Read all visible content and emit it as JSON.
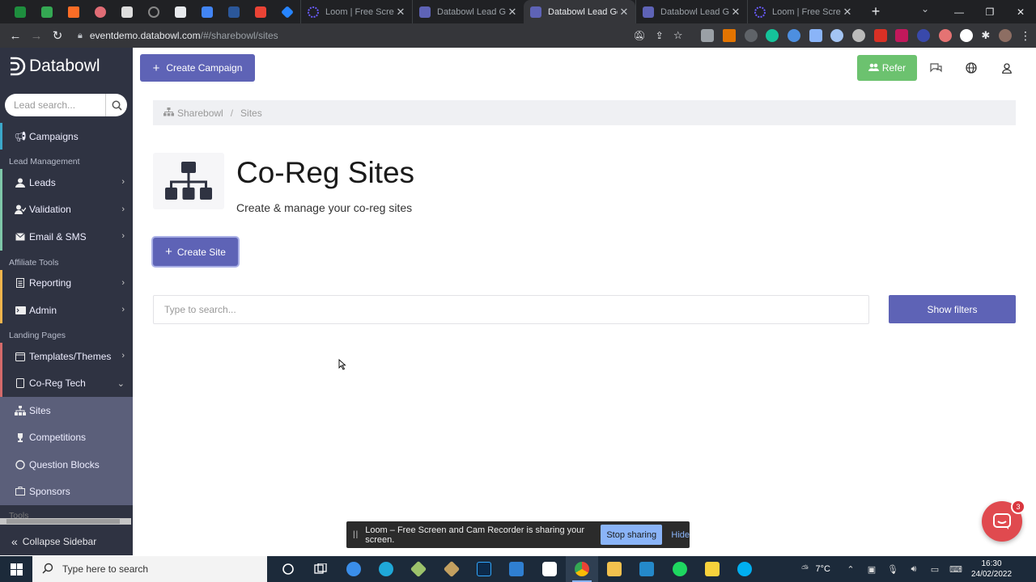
{
  "browser": {
    "tabs": [
      {
        "title": "Loom | Free Screen",
        "fav": "#6a5cff",
        "active": false
      },
      {
        "title": "Databowl Lead Gen",
        "fav": "#5e63b6",
        "active": false
      },
      {
        "title": "Databowl Lead Gen",
        "fav": "#5e63b6",
        "active": true
      },
      {
        "title": "Databowl Lead Gen",
        "fav": "#5e63b6",
        "active": false
      },
      {
        "title": "Loom | Free Screen",
        "fav": "#6a5cff",
        "active": false
      }
    ],
    "url_host": "eventdemo.databowl.com",
    "url_path": "/#/sharebowl/sites"
  },
  "sidebar": {
    "brand": "Databowl",
    "search_placeholder": "Lead search...",
    "campaigns": "Campaigns",
    "section_lead_management": "Lead Management",
    "leads": "Leads",
    "validation": "Validation",
    "email_sms": "Email & SMS",
    "section_affiliate": "Affiliate Tools",
    "reporting": "Reporting",
    "admin": "Admin",
    "section_landing": "Landing Pages",
    "templates": "Templates/Themes",
    "coreg": "Co-Reg Tech",
    "sites": "Sites",
    "competitions": "Competitions",
    "question_blocks": "Question Blocks",
    "sponsors": "Sponsors",
    "section_tools": "Tools",
    "collapse": "Collapse Sidebar"
  },
  "topbar": {
    "create_campaign": "Create Campaign",
    "refer": "Refer"
  },
  "breadcrumb": {
    "root": "Sharebowl",
    "current": "Sites"
  },
  "page": {
    "title": "Co-Reg Sites",
    "subtitle": "Create & manage your co-reg sites",
    "create_site": "Create Site",
    "search_placeholder": "Type to search...",
    "show_filters": "Show filters"
  },
  "loom_bar": {
    "message": "Loom – Free Screen and Cam Recorder is sharing your screen.",
    "stop": "Stop sharing",
    "hide": "Hide"
  },
  "chat": {
    "badge": "3"
  },
  "taskbar": {
    "search_placeholder": "Type here to search",
    "weather": "7°C",
    "time": "16:30",
    "date": "24/02/2022"
  },
  "colors": {
    "primary": "#5e63b6",
    "refer": "#6cc26f",
    "sidebar": "#2f3342"
  }
}
